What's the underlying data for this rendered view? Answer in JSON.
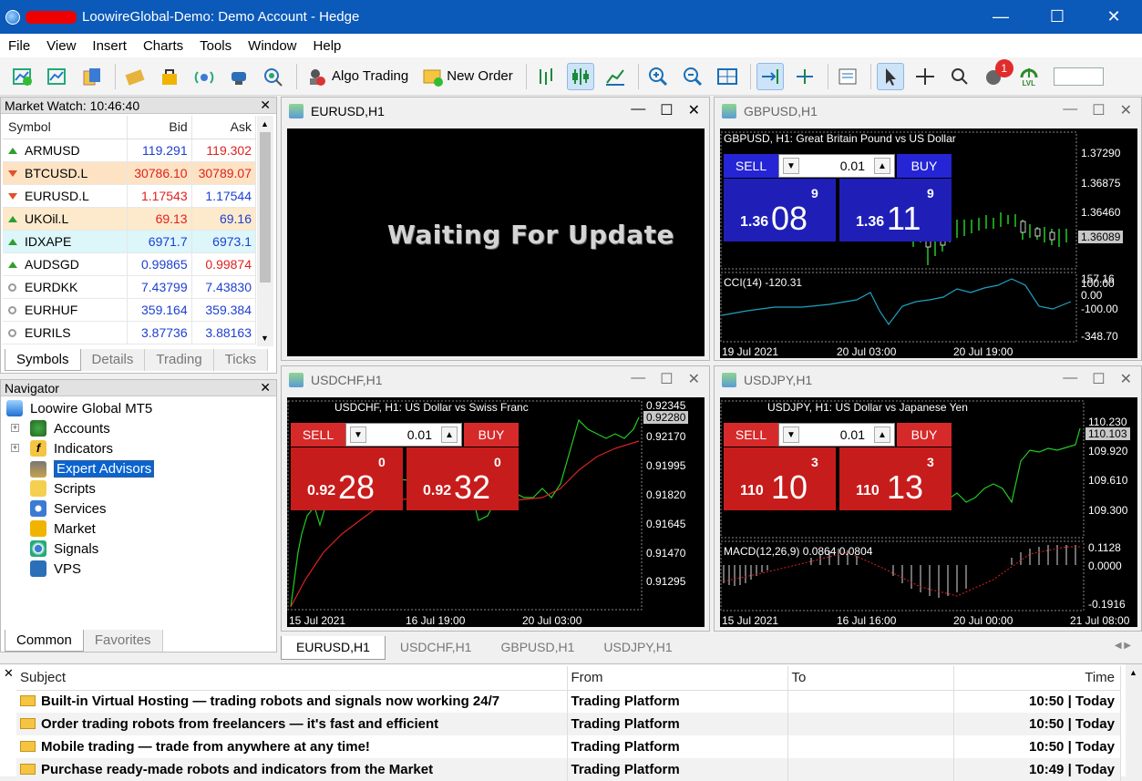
{
  "window": {
    "title": "LoowireGlobal-Demo: Demo Account - Hedge",
    "controls": {
      "minimize": "—",
      "maximize": "☐",
      "close": "✕"
    }
  },
  "menu": [
    "File",
    "View",
    "Insert",
    "Charts",
    "Tools",
    "Window",
    "Help"
  ],
  "toolbar": {
    "algo_trading": "Algo Trading",
    "new_order": "New Order",
    "notifications_count": "1",
    "lvl_label": "LVL"
  },
  "market_watch": {
    "header": "Market Watch: 10:46:40",
    "columns": [
      "Symbol",
      "Bid",
      "Ask"
    ],
    "rows": [
      {
        "symbol": "ARMUSD",
        "bid": "119.291",
        "ask": "119.302",
        "dir": "up"
      },
      {
        "symbol": "BTCUSD.L",
        "bid": "30786.10",
        "ask": "30789.07",
        "dir": "down"
      },
      {
        "symbol": "EURUSD.L",
        "bid": "1.17543",
        "ask": "1.17544",
        "dir": "down"
      },
      {
        "symbol": "UKOil.L",
        "bid": "69.13",
        "ask": "69.16",
        "dir": "up"
      },
      {
        "symbol": "IDXAPE",
        "bid": "6971.7",
        "ask": "6973.1",
        "dir": "up"
      },
      {
        "symbol": "AUDSGD",
        "bid": "0.99865",
        "ask": "0.99874",
        "dir": "up"
      },
      {
        "symbol": "EURDKK",
        "bid": "7.43799",
        "ask": "7.43830",
        "dir": "none"
      },
      {
        "symbol": "EURHUF",
        "bid": "359.164",
        "ask": "359.384",
        "dir": "none"
      },
      {
        "symbol": "EURILS",
        "bid": "3.87736",
        "ask": "3.88163",
        "dir": "none"
      }
    ],
    "tabs": [
      "Symbols",
      "Details",
      "Trading",
      "Ticks"
    ]
  },
  "navigator": {
    "header": "Navigator",
    "root": "Loowire Global MT5",
    "items": [
      "Accounts",
      "Indicators",
      "Expert Advisors",
      "Scripts",
      "Services",
      "Market",
      "Signals",
      "VPS"
    ],
    "tabs": [
      "Common",
      "Favorites"
    ]
  },
  "charts": {
    "eurusd": {
      "title": "EURUSD,H1",
      "waiting": "Waiting For Update"
    },
    "gbpusd": {
      "title": "GBPUSD,H1",
      "desc": "GBPUSD, H1:  Great Britain Pound vs US Dollar",
      "sell": "SELL",
      "buy": "BUY",
      "lot": "0.01",
      "sell_price": {
        "small": "1.36",
        "big": "08",
        "sup": "9"
      },
      "buy_price": {
        "small": "1.36",
        "big": "11",
        "sup": "9"
      },
      "y_ticks": [
        "1.37290",
        "1.36875",
        "1.36460",
        "1.36089"
      ],
      "indicator": "CCI(14) -120.31",
      "ind_ticks": [
        "157.16",
        "100.00",
        "0.00",
        "-100.00",
        "-348.70"
      ],
      "x_ticks": [
        "19 Jul 2021",
        "20 Jul 03:00",
        "20 Jul 19:00"
      ]
    },
    "usdchf": {
      "title": "USDCHF,H1",
      "desc": "USDCHF, H1:  US Dollar vs Swiss Franc",
      "sell": "SELL",
      "buy": "BUY",
      "lot": "0.01",
      "sell_price": {
        "small": "0.92",
        "big": "28",
        "sup": "0"
      },
      "buy_price": {
        "small": "0.92",
        "big": "32",
        "sup": "0"
      },
      "y_ticks": [
        "0.92345",
        "0.92280",
        "0.92170",
        "0.91995",
        "0.91820",
        "0.91645",
        "0.91470",
        "0.91295"
      ],
      "x_ticks": [
        "15 Jul 2021",
        "16 Jul 19:00",
        "20 Jul 03:00"
      ]
    },
    "usdjpy": {
      "title": "USDJPY,H1",
      "desc": "USDJPY, H1:  US Dollar vs Japanese Yen",
      "sell": "SELL",
      "buy": "BUY",
      "lot": "0.01",
      "sell_price": {
        "small": "110",
        "big": "10",
        "sup": "3"
      },
      "buy_price": {
        "small": "110",
        "big": "13",
        "sup": "3"
      },
      "y_ticks": [
        "110.230",
        "110.103",
        "109.920",
        "109.610",
        "109.300"
      ],
      "indicator": "MACD(12,26,9) 0.0864 0.0804",
      "ind_ticks": [
        "0.1128",
        "0.0000",
        "-0.1916"
      ],
      "x_ticks": [
        "15 Jul 2021",
        "16 Jul 16:00",
        "20 Jul 00:00",
        "21 Jul 08:00"
      ]
    }
  },
  "chart_tabs": [
    "EURUSD,H1",
    "USDCHF,H1",
    "GBPUSD,H1",
    "USDJPY,H1"
  ],
  "mailbox": {
    "columns": [
      "Subject",
      "From",
      "To",
      "Time"
    ],
    "rows": [
      {
        "subject": "Built-in Virtual Hosting — trading robots and signals now working 24/7",
        "from": "Trading Platform",
        "to": "",
        "time": "10:50 | Today"
      },
      {
        "subject": "Order trading robots from freelancers — it's fast and efficient",
        "from": "Trading Platform",
        "to": "",
        "time": "10:50 | Today"
      },
      {
        "subject": "Mobile trading — trade from anywhere at any time!",
        "from": "Trading Platform",
        "to": "",
        "time": "10:50 | Today"
      },
      {
        "subject": "Purchase ready-made robots and indicators from the Market",
        "from": "Trading Platform",
        "to": "",
        "time": "10:49 | Today"
      }
    ]
  }
}
